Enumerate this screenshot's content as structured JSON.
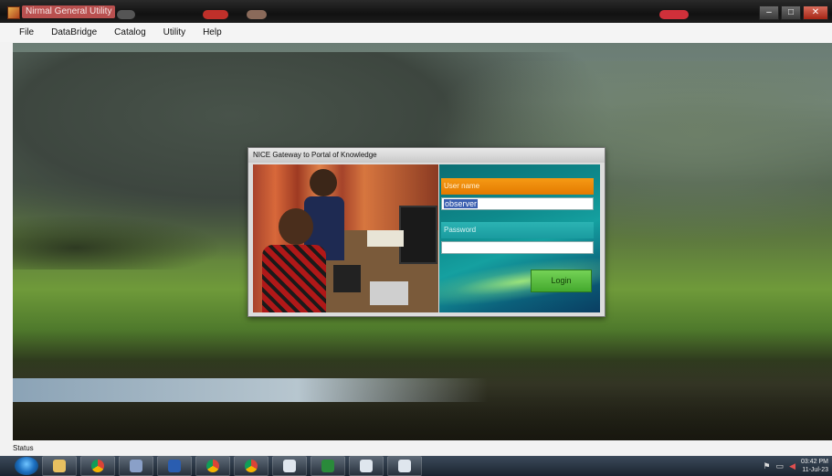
{
  "window": {
    "title": "Nirmal General Utility",
    "controls": {
      "minimize": "–",
      "maximize": "□",
      "close": "✕"
    }
  },
  "menu": [
    "File",
    "DataBridge",
    "Catalog",
    "Utility",
    "Help"
  ],
  "dialog": {
    "title": "NICE Gateway to Portal of Knowledge",
    "username_label": "User name",
    "username_value": "observer",
    "password_label": "Password",
    "password_value": "",
    "login_label": "Login"
  },
  "status": {
    "label": "Status"
  },
  "taskbar": {
    "items": [
      "start-orb-icon",
      "folder-icon",
      "chrome-icon",
      "media-icon",
      "word-icon",
      "chrome-icon",
      "chrome-icon",
      "window-icon",
      "excel-icon",
      "window-icon",
      "window-icon"
    ],
    "clock_time": "03:42 PM",
    "clock_date": "11-Jul-23"
  },
  "colors": {
    "username_bg": "#f08c0a",
    "password_bg": "#22a8a8",
    "login_bg": "#5cbf40",
    "selection": "#3b5fb0"
  }
}
